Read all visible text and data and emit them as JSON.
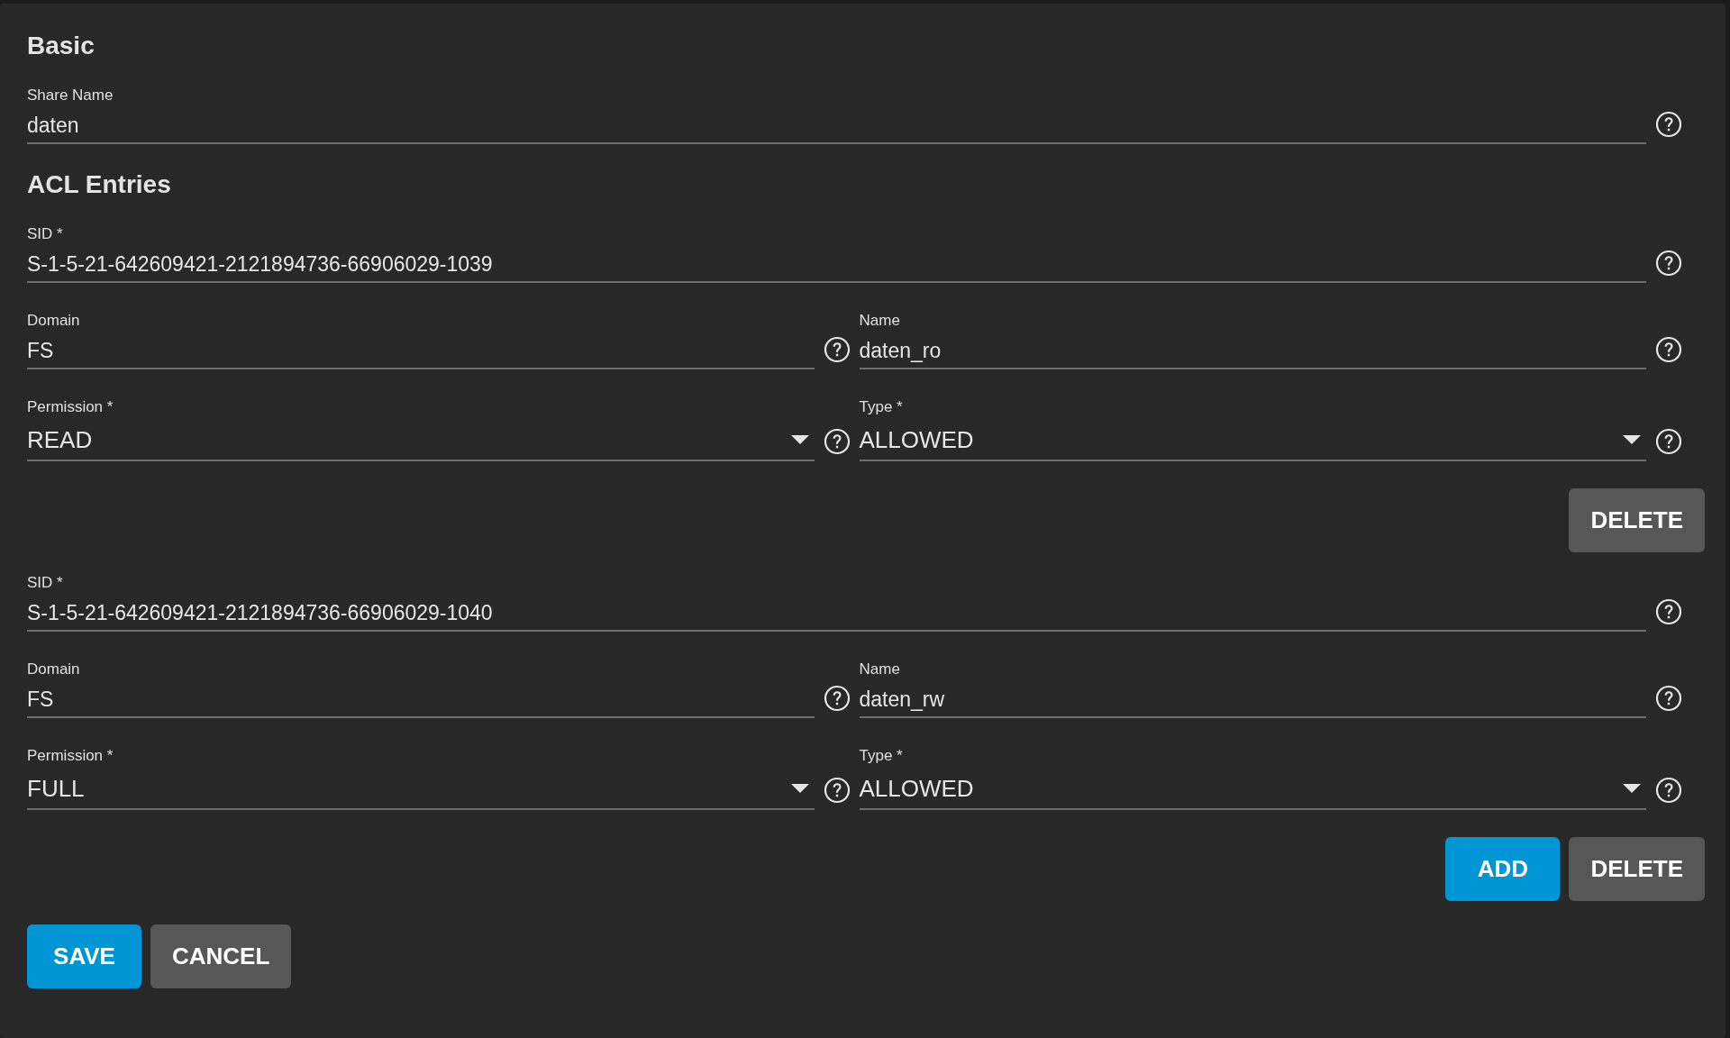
{
  "basic": {
    "heading": "Basic",
    "share_name": {
      "label": "Share Name",
      "value": "daten"
    }
  },
  "acl": {
    "heading": "ACL Entries",
    "entries": [
      {
        "sid": {
          "label": "SID *",
          "value": "S-1-5-21-642609421-2121894736-66906029-1039"
        },
        "domain": {
          "label": "Domain",
          "value": "FS"
        },
        "name": {
          "label": "Name",
          "value": "daten_ro"
        },
        "permission": {
          "label": "Permission *",
          "value": "READ"
        },
        "type": {
          "label": "Type *",
          "value": "ALLOWED"
        },
        "buttons": [
          {
            "label": "DELETE",
            "kind": "secondary"
          }
        ]
      },
      {
        "sid": {
          "label": "SID *",
          "value": "S-1-5-21-642609421-2121894736-66906029-1040"
        },
        "domain": {
          "label": "Domain",
          "value": "FS"
        },
        "name": {
          "label": "Name",
          "value": "daten_rw"
        },
        "permission": {
          "label": "Permission *",
          "value": "FULL"
        },
        "type": {
          "label": "Type *",
          "value": "ALLOWED"
        },
        "buttons": [
          {
            "label": "ADD",
            "kind": "primary"
          },
          {
            "label": "DELETE",
            "kind": "secondary"
          }
        ]
      }
    ]
  },
  "actions": [
    {
      "label": "SAVE",
      "kind": "primary"
    },
    {
      "label": "CANCEL",
      "kind": "secondary"
    }
  ]
}
